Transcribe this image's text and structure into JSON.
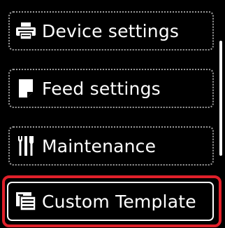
{
  "menu": {
    "items": [
      {
        "label": "Device settings",
        "icon": "printer-icon"
      },
      {
        "label": "Feed settings",
        "icon": "paper-feed-icon"
      },
      {
        "label": "Maintenance",
        "icon": "tools-icon"
      },
      {
        "label": "Custom Template",
        "icon": "template-icon"
      }
    ],
    "selected_index": 3
  },
  "colors": {
    "background": "#000000",
    "text": "#ffffff",
    "item_border": "#9a9a9a",
    "selection": "#e0202a"
  }
}
